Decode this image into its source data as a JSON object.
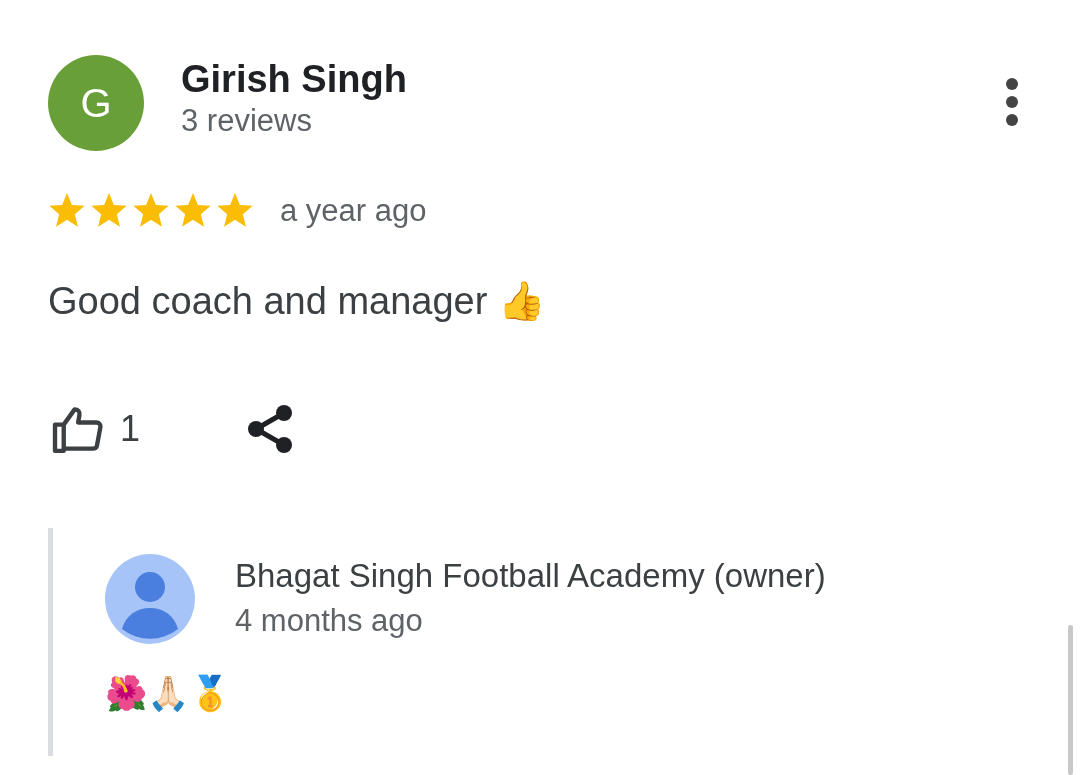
{
  "review": {
    "avatar_letter": "G",
    "author": "Girish Singh",
    "review_count": "3 reviews",
    "stars": 5,
    "time": "a year ago",
    "text": "Good coach and manager 👍",
    "likes": "1"
  },
  "owner_reply": {
    "author": "Bhagat Singh Football Academy (owner)",
    "time": "4 months ago",
    "text": "🌺🙏🏻🥇"
  }
}
